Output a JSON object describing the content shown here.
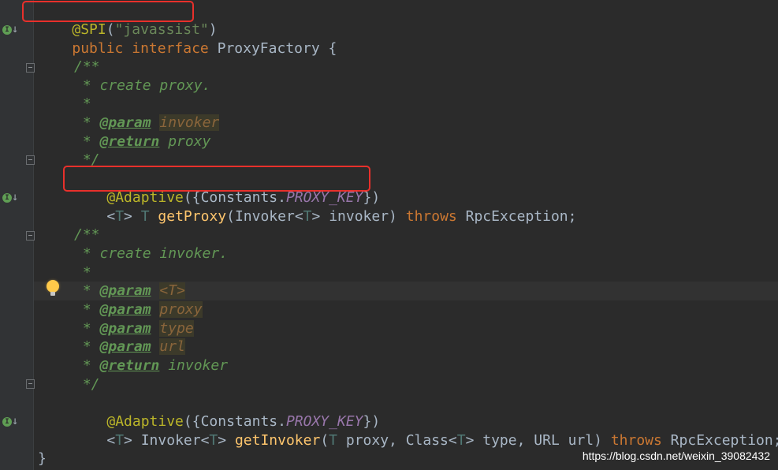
{
  "code": {
    "l1": {
      "ann": "@SPI",
      "p1": "(",
      "str": "\"javassist\"",
      "p2": ")"
    },
    "l2": {
      "kw1": "public",
      "kw2": "interface",
      "rest": " ProxyFactory {"
    },
    "l4": {
      "text": "/**"
    },
    "l5": {
      "text": " * create proxy."
    },
    "l6": {
      "text": " *"
    },
    "l7": {
      "lead": " * ",
      "tag": "@param",
      "sp": " ",
      "ref": "invoker"
    },
    "l8": {
      "lead": " * ",
      "tag": "@return",
      "rest": " proxy"
    },
    "l9": {
      "text": " */"
    },
    "l10": {
      "ann": "@Adaptive",
      "p1": "({Constants.",
      "const": "PROXY_KEY",
      "p2": "})"
    },
    "l11": {
      "lt": "<",
      "t1": "T",
      "gt": "> ",
      "t2": "T",
      "sp": " ",
      "meth": "getProxy",
      "a1": "(Invoker<",
      "t3": "T",
      "a2": "> invoker) ",
      "kw": "throws",
      "rest": " RpcException;"
    },
    "l13": {
      "text": "/**"
    },
    "l14": {
      "text": " * create invoker."
    },
    "l15": {
      "text": " *"
    },
    "l16": {
      "lead": " * ",
      "tag": "@param",
      "sp": " ",
      "ref": "<T>"
    },
    "l17": {
      "lead": " * ",
      "tag": "@param",
      "sp": " ",
      "ref": "proxy"
    },
    "l18": {
      "lead": " * ",
      "tag": "@param",
      "sp": " ",
      "ref": "type"
    },
    "l19": {
      "lead": " * ",
      "tag": "@param",
      "sp": " ",
      "ref": "url"
    },
    "l20": {
      "lead": " * ",
      "tag": "@return",
      "rest": " invoker"
    },
    "l21": {
      "text": " */"
    },
    "l22": {
      "ann": "@Adaptive",
      "p1": "({Constants.",
      "const": "PROXY_KEY",
      "p2": "})"
    },
    "l23": {
      "lt": "<",
      "t1": "T",
      "gt": "> Invoker<",
      "t2": "T",
      "gt2": "> ",
      "meth": "getInvoker",
      "a1": "(",
      "t3": "T",
      "a2": " proxy, Class<",
      "t4": "T",
      "a3": "> type, URL url) ",
      "kw": "throws",
      "rest": " RpcException;"
    },
    "l25": {
      "text": "}"
    }
  },
  "gutter_icons": {
    "implemented": "implemented-interface-icon",
    "fold": "fold-marker-icon",
    "intention": "lightbulb-icon"
  },
  "annotations": {
    "highlight_color": "#e8302b"
  },
  "watermark": "https://blog.csdn.net/weixin_39082432"
}
